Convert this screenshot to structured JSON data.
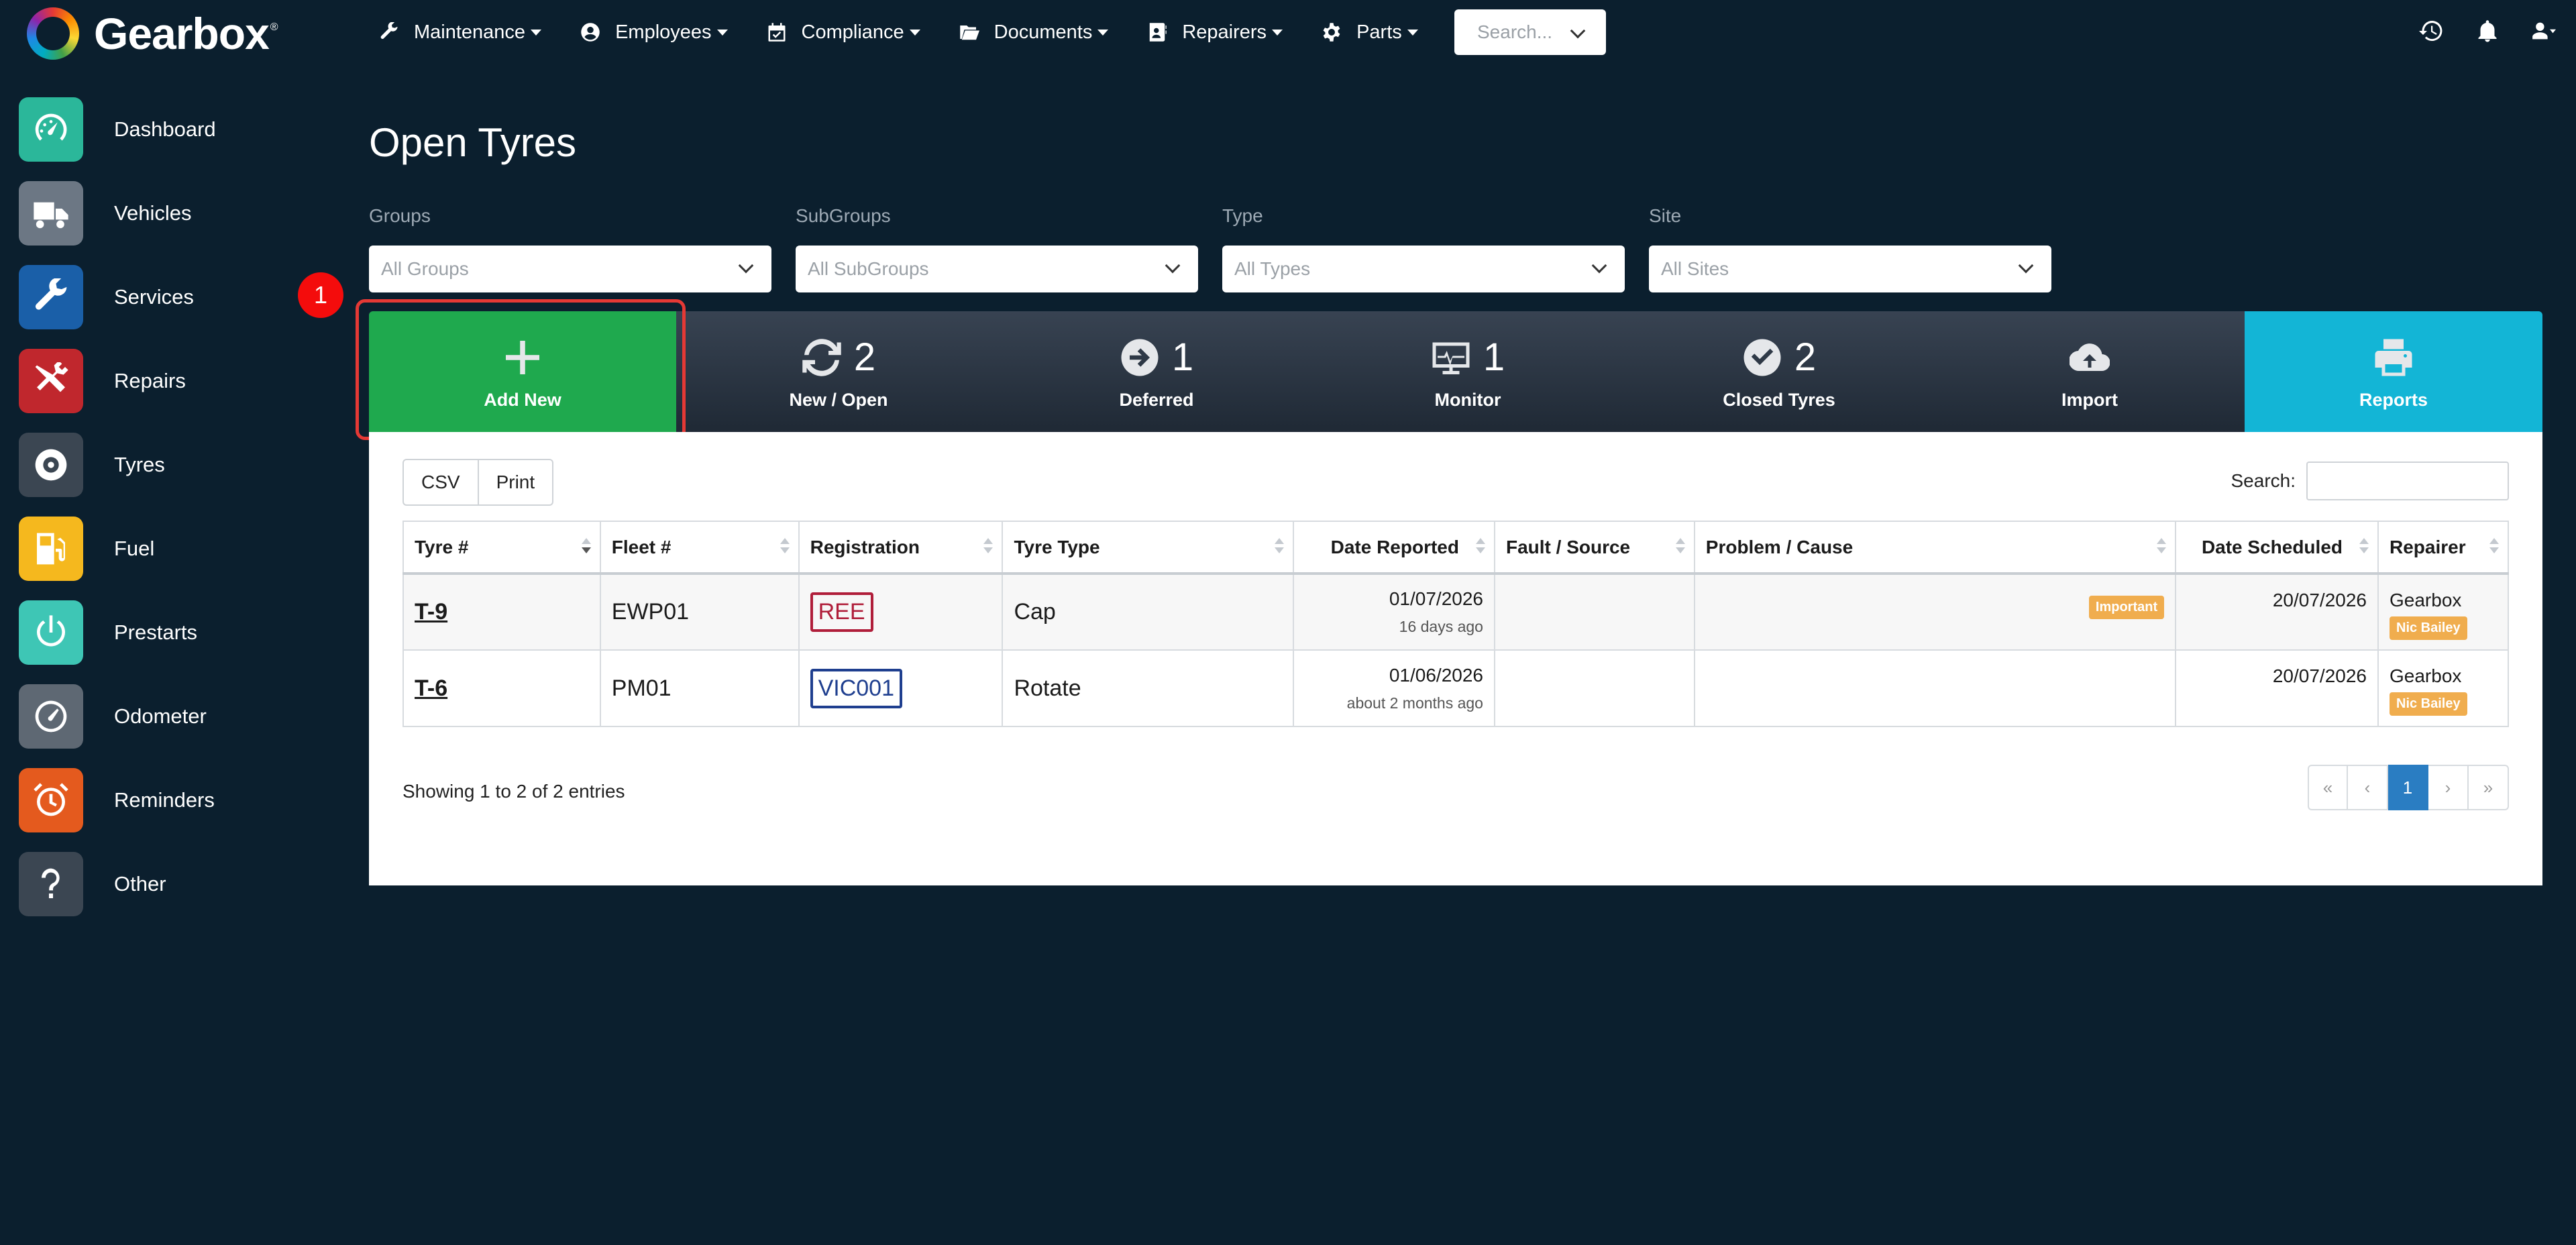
{
  "brand": {
    "name": "Gearbox",
    "reg": "®"
  },
  "menu": [
    {
      "label": "Maintenance",
      "icon": "wrench-icon"
    },
    {
      "label": "Employees",
      "icon": "user-circle-icon"
    },
    {
      "label": "Compliance",
      "icon": "calendar-check-icon"
    },
    {
      "label": "Documents",
      "icon": "folder-open-icon"
    },
    {
      "label": "Repairers",
      "icon": "contact-card-icon"
    },
    {
      "label": "Parts",
      "icon": "cog-icon"
    }
  ],
  "search": {
    "placeholder": "Search..."
  },
  "sidebar": [
    {
      "label": "Dashboard",
      "color": "#2bb79a"
    },
    {
      "label": "Vehicles",
      "color": "#6c7784"
    },
    {
      "label": "Services",
      "color": "#1a5fa8"
    },
    {
      "label": "Repairs",
      "color": "#c0272d"
    },
    {
      "label": "Tyres",
      "color": "#3b4652"
    },
    {
      "label": "Fuel",
      "color": "#f5b81e"
    },
    {
      "label": "Prestarts",
      "color": "#3ec6b5"
    },
    {
      "label": "Odometer",
      "color": "#5e6873"
    },
    {
      "label": "Reminders",
      "color": "#e45a1e"
    },
    {
      "label": "Other",
      "color": "#3b4652"
    }
  ],
  "page": {
    "title": "Open Tyres"
  },
  "filters": [
    {
      "label": "Groups",
      "value": "All Groups"
    },
    {
      "label": "SubGroups",
      "value": "All SubGroups"
    },
    {
      "label": "Type",
      "value": "All Types"
    },
    {
      "label": "Site",
      "value": "All Sites"
    }
  ],
  "stats": {
    "add": {
      "label": "Add New"
    },
    "new_open": {
      "count": "2",
      "label": "New / Open"
    },
    "deferred": {
      "count": "1",
      "label": "Deferred"
    },
    "monitor": {
      "count": "1",
      "label": "Monitor"
    },
    "closed": {
      "count": "2",
      "label": "Closed Tyres"
    },
    "import": {
      "label": "Import"
    },
    "reports": {
      "label": "Reports"
    }
  },
  "annotation": {
    "badge": "1"
  },
  "table": {
    "buttons": {
      "csv": "CSV",
      "print": "Print"
    },
    "search_label": "Search:",
    "columns": [
      "Tyre #",
      "Fleet #",
      "Registration",
      "Tyre Type",
      "Date Reported",
      "Fault / Source",
      "Problem / Cause",
      "Date Scheduled",
      "Repairer"
    ],
    "rows": [
      {
        "tyre": "T-9",
        "fleet": "EWP01",
        "registration": "REE",
        "plate_color": "#b01e3a",
        "tyre_type": "Cap",
        "date_reported": "01/07/2026",
        "date_ago": "16 days ago",
        "fault": "",
        "problem_badge": "Important",
        "date_scheduled": "20/07/2026",
        "repairer": "Gearbox",
        "assignee": "Nic Bailey"
      },
      {
        "tyre": "T-6",
        "fleet": "PM01",
        "registration": "VIC001",
        "plate_color": "#1f3f8f",
        "tyre_type": "Rotate",
        "date_reported": "01/06/2026",
        "date_ago": "about 2 months ago",
        "fault": "",
        "problem_badge": "",
        "date_scheduled": "20/07/2026",
        "repairer": "Gearbox",
        "assignee": "Nic Bailey"
      }
    ],
    "info": "Showing 1 to 2 of 2 entries",
    "pager": {
      "first": "«",
      "prev": "‹",
      "current": "1",
      "next": "›",
      "last": "»"
    }
  }
}
